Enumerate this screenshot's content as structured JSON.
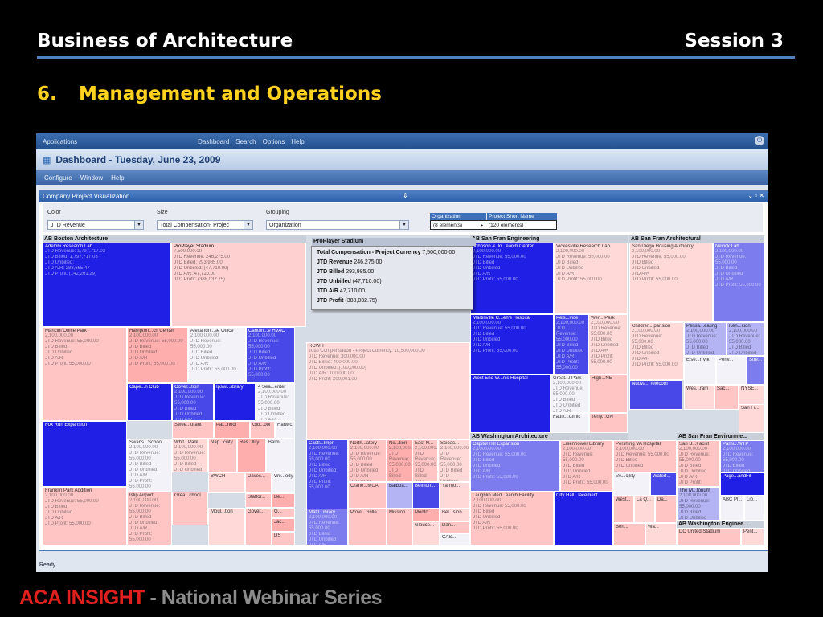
{
  "slide": {
    "title_left": "Business of Architecture",
    "title_right": "Session 3",
    "section_number": "6.",
    "section_title": "Management and Operations",
    "footer_brand": "ACA INSIGHT",
    "footer_rest": " - National Webinar Series"
  },
  "app": {
    "menu": [
      "Applications",
      "Dashboard",
      "Search",
      "Options",
      "Help"
    ],
    "dashboard_title": "Dashboard - Tuesday, June 23, 2009",
    "toolbar": [
      "Configure",
      "Window",
      "Help"
    ],
    "status": "Ready"
  },
  "panel": {
    "title": "Company Project Visualization",
    "controls": {
      "color_label": "Color",
      "color_value": "JTD Revenue",
      "size_label": "Size",
      "size_value": "Total Compensation- Projec",
      "grouping_label": "Grouping",
      "grouping_value": "Organization",
      "tree_col1": "Organization",
      "tree_col2": "Project Short Name",
      "tree_val1": "(8 elements)",
      "tree_val2": "(120 elements)"
    }
  },
  "treemap": {
    "groups": [
      "AB Boston Architecture",
      "ProPlayer Stadium",
      "AB San Fran Engineering",
      "AB San Fran Architectural",
      "AB Washington Architecture",
      "AB San Fran Environme...",
      "AB Washington Enginee..."
    ],
    "cells": [
      "Adelphi Research Lab",
      "ProPlayer Stadium",
      "Mancini Office Park",
      "Hampton...ch Center",
      "Alexandri...se Office",
      "Canton...e HVAC",
      "Cape...n Club",
      "Gover...tion",
      "Ipswi...ibrary",
      "4 Sea...enter",
      "Fox Run Expansion",
      "Swee...urant",
      "Pal...hool",
      "Glb...ool",
      "Harwic...",
      "Swans...School",
      "Whit...Park",
      "Nap...cility",
      "Res...llity",
      "Balm...",
      "Franklin Park Addition",
      "Islip Airport",
      "BWCH",
      "Daves...",
      "We...ody",
      "Staffor...",
      "Be...",
      "G...",
      "Grea...chool",
      "Moul...tion",
      "Gover...",
      "Jac...",
      "DS",
      "RCWH",
      "Castl...Impr",
      "North...atory",
      "Ne...tion",
      "East N...",
      "Scioac...",
      "Crane...MCA",
      "Balboa...",
      "Belmon...",
      "Yarmo...",
      "Mattl...ibrary",
      "Provi...Grille",
      "Mission...",
      "Medfo...",
      "Bel...sion",
      "Glouce...",
      "Dan...",
      "CAS...",
      "Johnson & Jo...earch Center",
      "Vickesville Research Lab",
      "Martinville C...en's Hospital",
      "Pels...vice",
      "Wen...Park",
      "West End W...n's Hospital",
      "Great...l Park",
      "High...NE",
      "Terry...GN",
      "Faulk...Clinic",
      "San Diego Housing Authority",
      "Nevick Lab",
      "Children...pansion",
      "Pensa...eating",
      "Ken...ition",
      "Else...r Vik",
      "Penv...",
      "Stre...",
      "Nuova...Telecom",
      "Wes...ram",
      "Sac...",
      "NYSE...",
      "San Fr...",
      "Capitol Hill Expansion",
      "Eisenhower Library",
      "Pershing VA Hospital",
      "VA...cility",
      "Waterf...",
      "Laughlin Med...earch Facility",
      "City Hall...lacement",
      "West...",
      "La Q...",
      "Da...",
      "Ben...",
      "Wa...",
      "San B...Facilit",
      "Parni...WTP",
      "The M...torium",
      "Page...andFil",
      "ABC Pl...",
      "Lib...",
      "DC United Stadium",
      "Pent..."
    ],
    "adelphi_lines": [
      "JTD Revenue: 1,797,717.03",
      "JTD Billed: 1,797,717.03",
      "JTD Unbilled:",
      "JTD A/R: 288,665.47",
      "JTD Profit: (142,261.29)"
    ],
    "proplayer_lines": [
      "7,500,000.00",
      "JTD Revenue: 246,275.00",
      "JTD Billed: 293,985.00",
      "JTD Unbilled: (47,710.00)",
      "JTD A/R: 47,710.00",
      "JTD Profit: (388,032.75)"
    ],
    "rcwh_lines": [
      "Total Compensation - Project Currency: 10,500,000.00",
      "JTD Revenue: 300,000.00",
      "JTD Billed: 400,000.00",
      "JTD Unbilled: (100,000.00)",
      "JTD A/R: 100,000.00",
      "JTD Profit: 200,001.00"
    ],
    "generic_lines": [
      "2,100,000.00",
      "JTD Revenue: 55,000.00",
      "JTD Billed",
      "JTD Unbilled",
      "JTD A/R",
      "JTD Profit: 55,000.00"
    ]
  },
  "tooltip": {
    "title": "ProPlayer Stadium",
    "rows": [
      {
        "k": "Total Compensation - Project Currency",
        "v": "7,500,000.00"
      },
      {
        "k": "JTD Revenue",
        "v": "246,275.00"
      },
      {
        "k": "JTD Billed",
        "v": "293,985.00"
      },
      {
        "k": "JTD Unbilled",
        "v": "(47,710.00)"
      },
      {
        "k": "JTD A/R",
        "v": "47,710.00"
      },
      {
        "k": "JTD Profit",
        "v": "(388,032.75)"
      }
    ]
  }
}
